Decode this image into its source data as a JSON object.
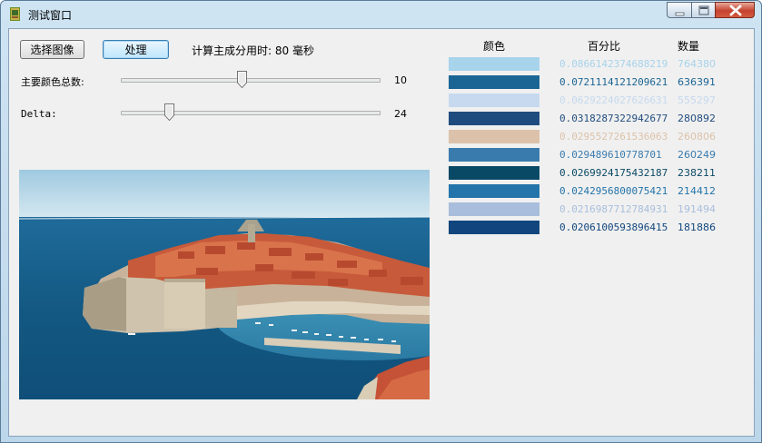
{
  "window": {
    "title": "测试窗口"
  },
  "toolbar": {
    "select_image_label": "选择图像",
    "process_label": "处理",
    "elapsed_text": "计算主成分用时: 80 毫秒"
  },
  "sliders": [
    {
      "label": "主要颜色总数:",
      "value": "10",
      "fraction": 0.47
    },
    {
      "label": "Delta:",
      "value": "24",
      "fraction": 0.19
    }
  ],
  "table": {
    "headers": {
      "color": "颜色",
      "percent": "百分比",
      "count": "数量"
    },
    "rows": [
      {
        "color": "#a7d3eb",
        "percent": "0.0866142374688219",
        "count": "764380"
      },
      {
        "color": "#1b6594",
        "percent": "0.0721114121209621",
        "count": "636391"
      },
      {
        "color": "#c6d9ef",
        "percent": "0.0629224027626631",
        "count": "555297"
      },
      {
        "color": "#1f4c7e",
        "percent": "0.0318287322942677",
        "count": "280892"
      },
      {
        "color": "#dcc2aa",
        "percent": "0.0295527261536063",
        "count": "260806"
      },
      {
        "color": "#3a7bae",
        "percent": "0.029489610778701",
        "count": "260249"
      },
      {
        "color": "#0a4966",
        "percent": "0.0269924175432187",
        "count": "238211"
      },
      {
        "color": "#2374aa",
        "percent": "0.0242956800075421",
        "count": "214412"
      },
      {
        "color": "#a8bedc",
        "percent": "0.0216987712784931",
        "count": "191494"
      },
      {
        "color": "#10467d",
        "percent": "0.0206100593896415",
        "count": "181886"
      }
    ]
  }
}
